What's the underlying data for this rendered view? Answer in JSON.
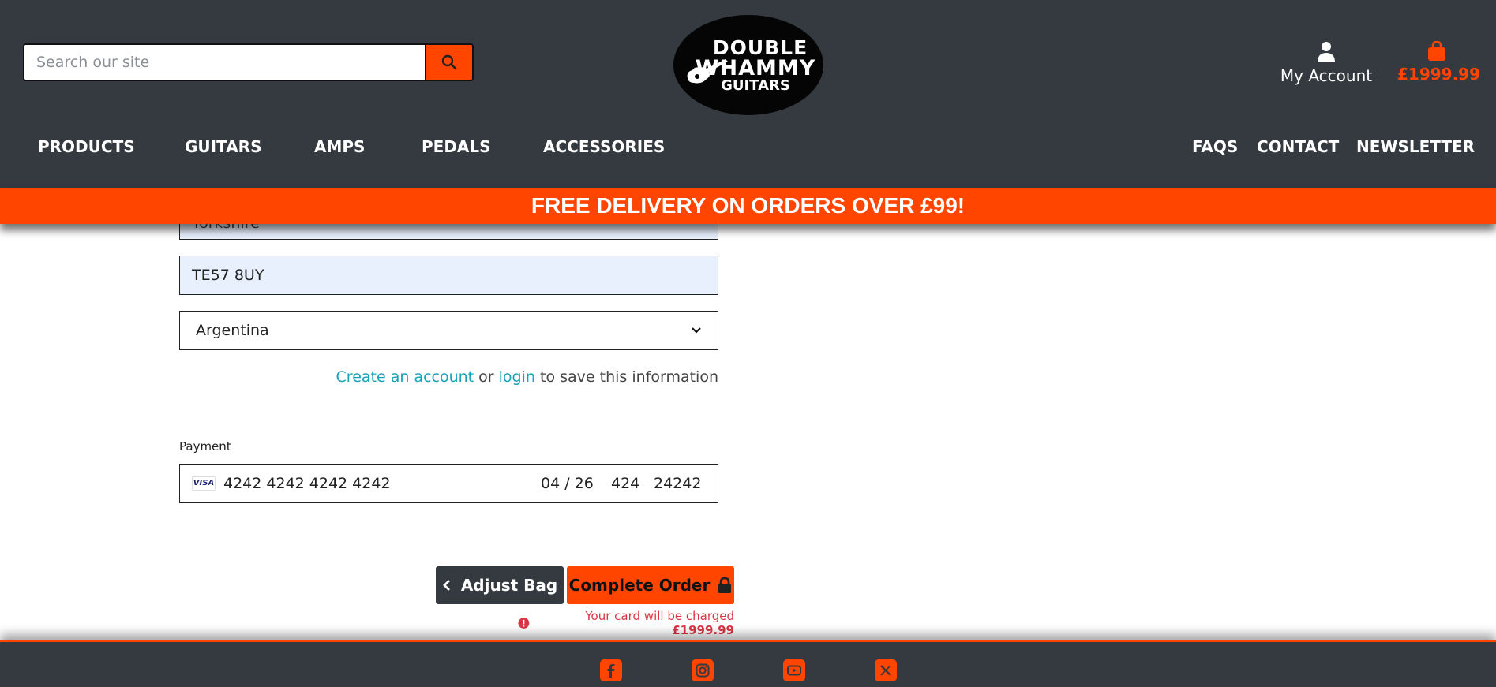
{
  "search": {
    "placeholder": "Search our site"
  },
  "logo": {
    "line1": "DOUBLE",
    "line2": "WHAMMY",
    "line3": "GUITARS"
  },
  "account": {
    "label": "My Account"
  },
  "cart": {
    "total": "£1999.99"
  },
  "nav": {
    "left": [
      "PRODUCTS",
      "GUITARS",
      "AMPS",
      "PEDALS",
      "ACCESSORIES"
    ],
    "right": [
      "FAQS",
      "CONTACT",
      "NEWSLETTER"
    ]
  },
  "banner": {
    "text": "FREE DELIVERY ON ORDERS OVER £99!"
  },
  "form": {
    "county_partial": "Yorkshire",
    "postcode": "TE57 8UY",
    "country": "Argentina",
    "save_info": {
      "create_account": "Create an account",
      "or": "or",
      "login": "login",
      "suffix": "to save this information"
    }
  },
  "payment": {
    "label": "Payment",
    "card_brand": "VISA",
    "card_number": "4242 4242 4242 4242",
    "expiry": "04 / 26",
    "cvc": "424",
    "postal": "24242"
  },
  "actions": {
    "adjust_bag": "Adjust Bag",
    "complete_order": "Complete Order",
    "charge_note_prefix": "Your card will be charged",
    "charge_amount": "£1999.99"
  },
  "colors": {
    "header_bg": "#343a40",
    "accent": "#ff4500",
    "link": "#17a2b8",
    "error": "#dc3545",
    "autofill": "#e8f0fe"
  },
  "footer": {
    "icons": [
      "facebook-icon",
      "instagram-icon",
      "youtube-icon",
      "x-twitter-icon"
    ]
  }
}
